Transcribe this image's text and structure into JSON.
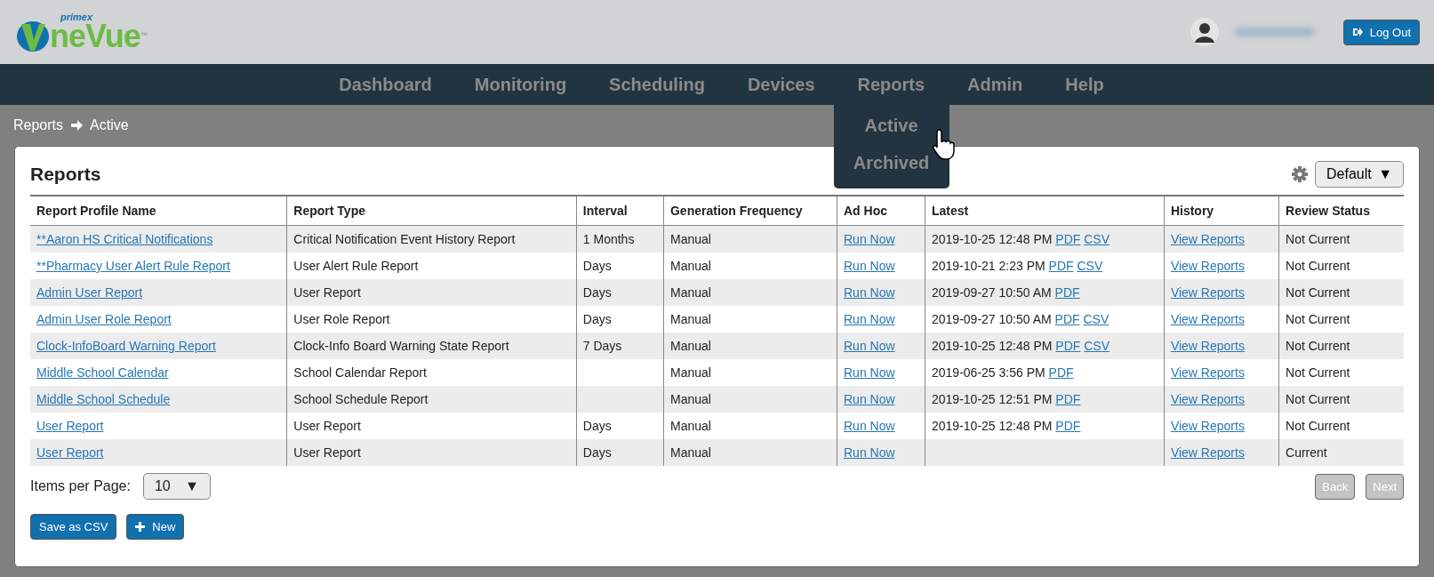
{
  "logo": {
    "tagline": "primex",
    "name": "neVue",
    "tm": "™"
  },
  "user": {
    "logout": "Log Out"
  },
  "nav": [
    {
      "label": "Dashboard"
    },
    {
      "label": "Monitoring"
    },
    {
      "label": "Scheduling"
    },
    {
      "label": "Devices"
    },
    {
      "label": "Reports",
      "menu": [
        "Active",
        "Archived"
      ]
    },
    {
      "label": "Admin"
    },
    {
      "label": "Help"
    }
  ],
  "breadcrumb": [
    "Reports",
    "Active"
  ],
  "card": {
    "title": "Reports",
    "view_select": "Default",
    "select_arrow": "▼"
  },
  "table": {
    "columns": [
      "Report Profile Name",
      "Report Type",
      "Interval",
      "Generation Frequency",
      "Ad Hoc",
      "Latest",
      "History",
      "Review Status"
    ],
    "rows": [
      {
        "name": "**Aaron HS Critical Notifications",
        "type": "Critical Notification Event History Report",
        "interval": "1 Months",
        "frequency": "Manual",
        "adhoc": "Run Now",
        "latest": "2019-10-25 12:48 PM",
        "files": [
          "PDF",
          "CSV"
        ],
        "history": "View Reports",
        "status": "Not Current"
      },
      {
        "name": "**Pharmacy User Alert Rule Report",
        "type": "User Alert Rule Report",
        "interval": "Days",
        "frequency": "Manual",
        "adhoc": "Run Now",
        "latest": "2019-10-21 2:23 PM",
        "files": [
          "PDF",
          "CSV"
        ],
        "history": "View Reports",
        "status": "Not Current"
      },
      {
        "name": "Admin User Report",
        "type": "User Report",
        "interval": "Days",
        "frequency": "Manual",
        "adhoc": "Run Now",
        "latest": "2019-09-27 10:50 AM",
        "files": [
          "PDF"
        ],
        "history": "View Reports",
        "status": "Not Current"
      },
      {
        "name": "Admin User Role Report",
        "type": "User Role Report",
        "interval": "Days",
        "frequency": "Manual",
        "adhoc": "Run Now",
        "latest": "2019-09-27 10:50 AM",
        "files": [
          "PDF",
          "CSV"
        ],
        "history": "View Reports",
        "status": "Not Current"
      },
      {
        "name": "Clock-InfoBoard Warning Report",
        "type": "Clock-Info Board Warning State Report",
        "interval": "7 Days",
        "frequency": "Manual",
        "adhoc": "Run Now",
        "latest": "2019-10-25 12:48 PM",
        "files": [
          "PDF",
          "CSV"
        ],
        "history": "View Reports",
        "status": "Not Current"
      },
      {
        "name": "Middle School Calendar",
        "type": "School Calendar Report",
        "frequency": "Manual",
        "adhoc": "Run Now",
        "latest": "2019-06-25 3:56 PM",
        "files": [
          "PDF"
        ],
        "history": "View Reports",
        "status": "Not Current"
      },
      {
        "name": "Middle School Schedule",
        "type": "School Schedule Report",
        "frequency": "Manual",
        "adhoc": "Run Now",
        "latest": "2019-10-25 12:51 PM",
        "files": [
          "PDF"
        ],
        "history": "View Reports",
        "status": "Not Current"
      },
      {
        "name": "User Report",
        "type": "User Report",
        "interval": "Days",
        "frequency": "Manual",
        "adhoc": "Run Now",
        "latest": "2019-10-25 12:48 PM",
        "files": [
          "PDF"
        ],
        "history": "View Reports",
        "status": "Not Current"
      },
      {
        "name": "User Report",
        "type": "User Report",
        "interval": "Days",
        "frequency": "Manual",
        "adhoc": "Run Now",
        "history": "View Reports",
        "status": "Current"
      }
    ]
  },
  "pager": {
    "label": "Items per Page:",
    "size": "10",
    "arrow": "▼",
    "back": {
      "label": "Back",
      "disabled": true
    },
    "next": {
      "label": "Next",
      "disabled": true
    }
  },
  "actions": {
    "save": "Save as CSV",
    "new": "New"
  }
}
